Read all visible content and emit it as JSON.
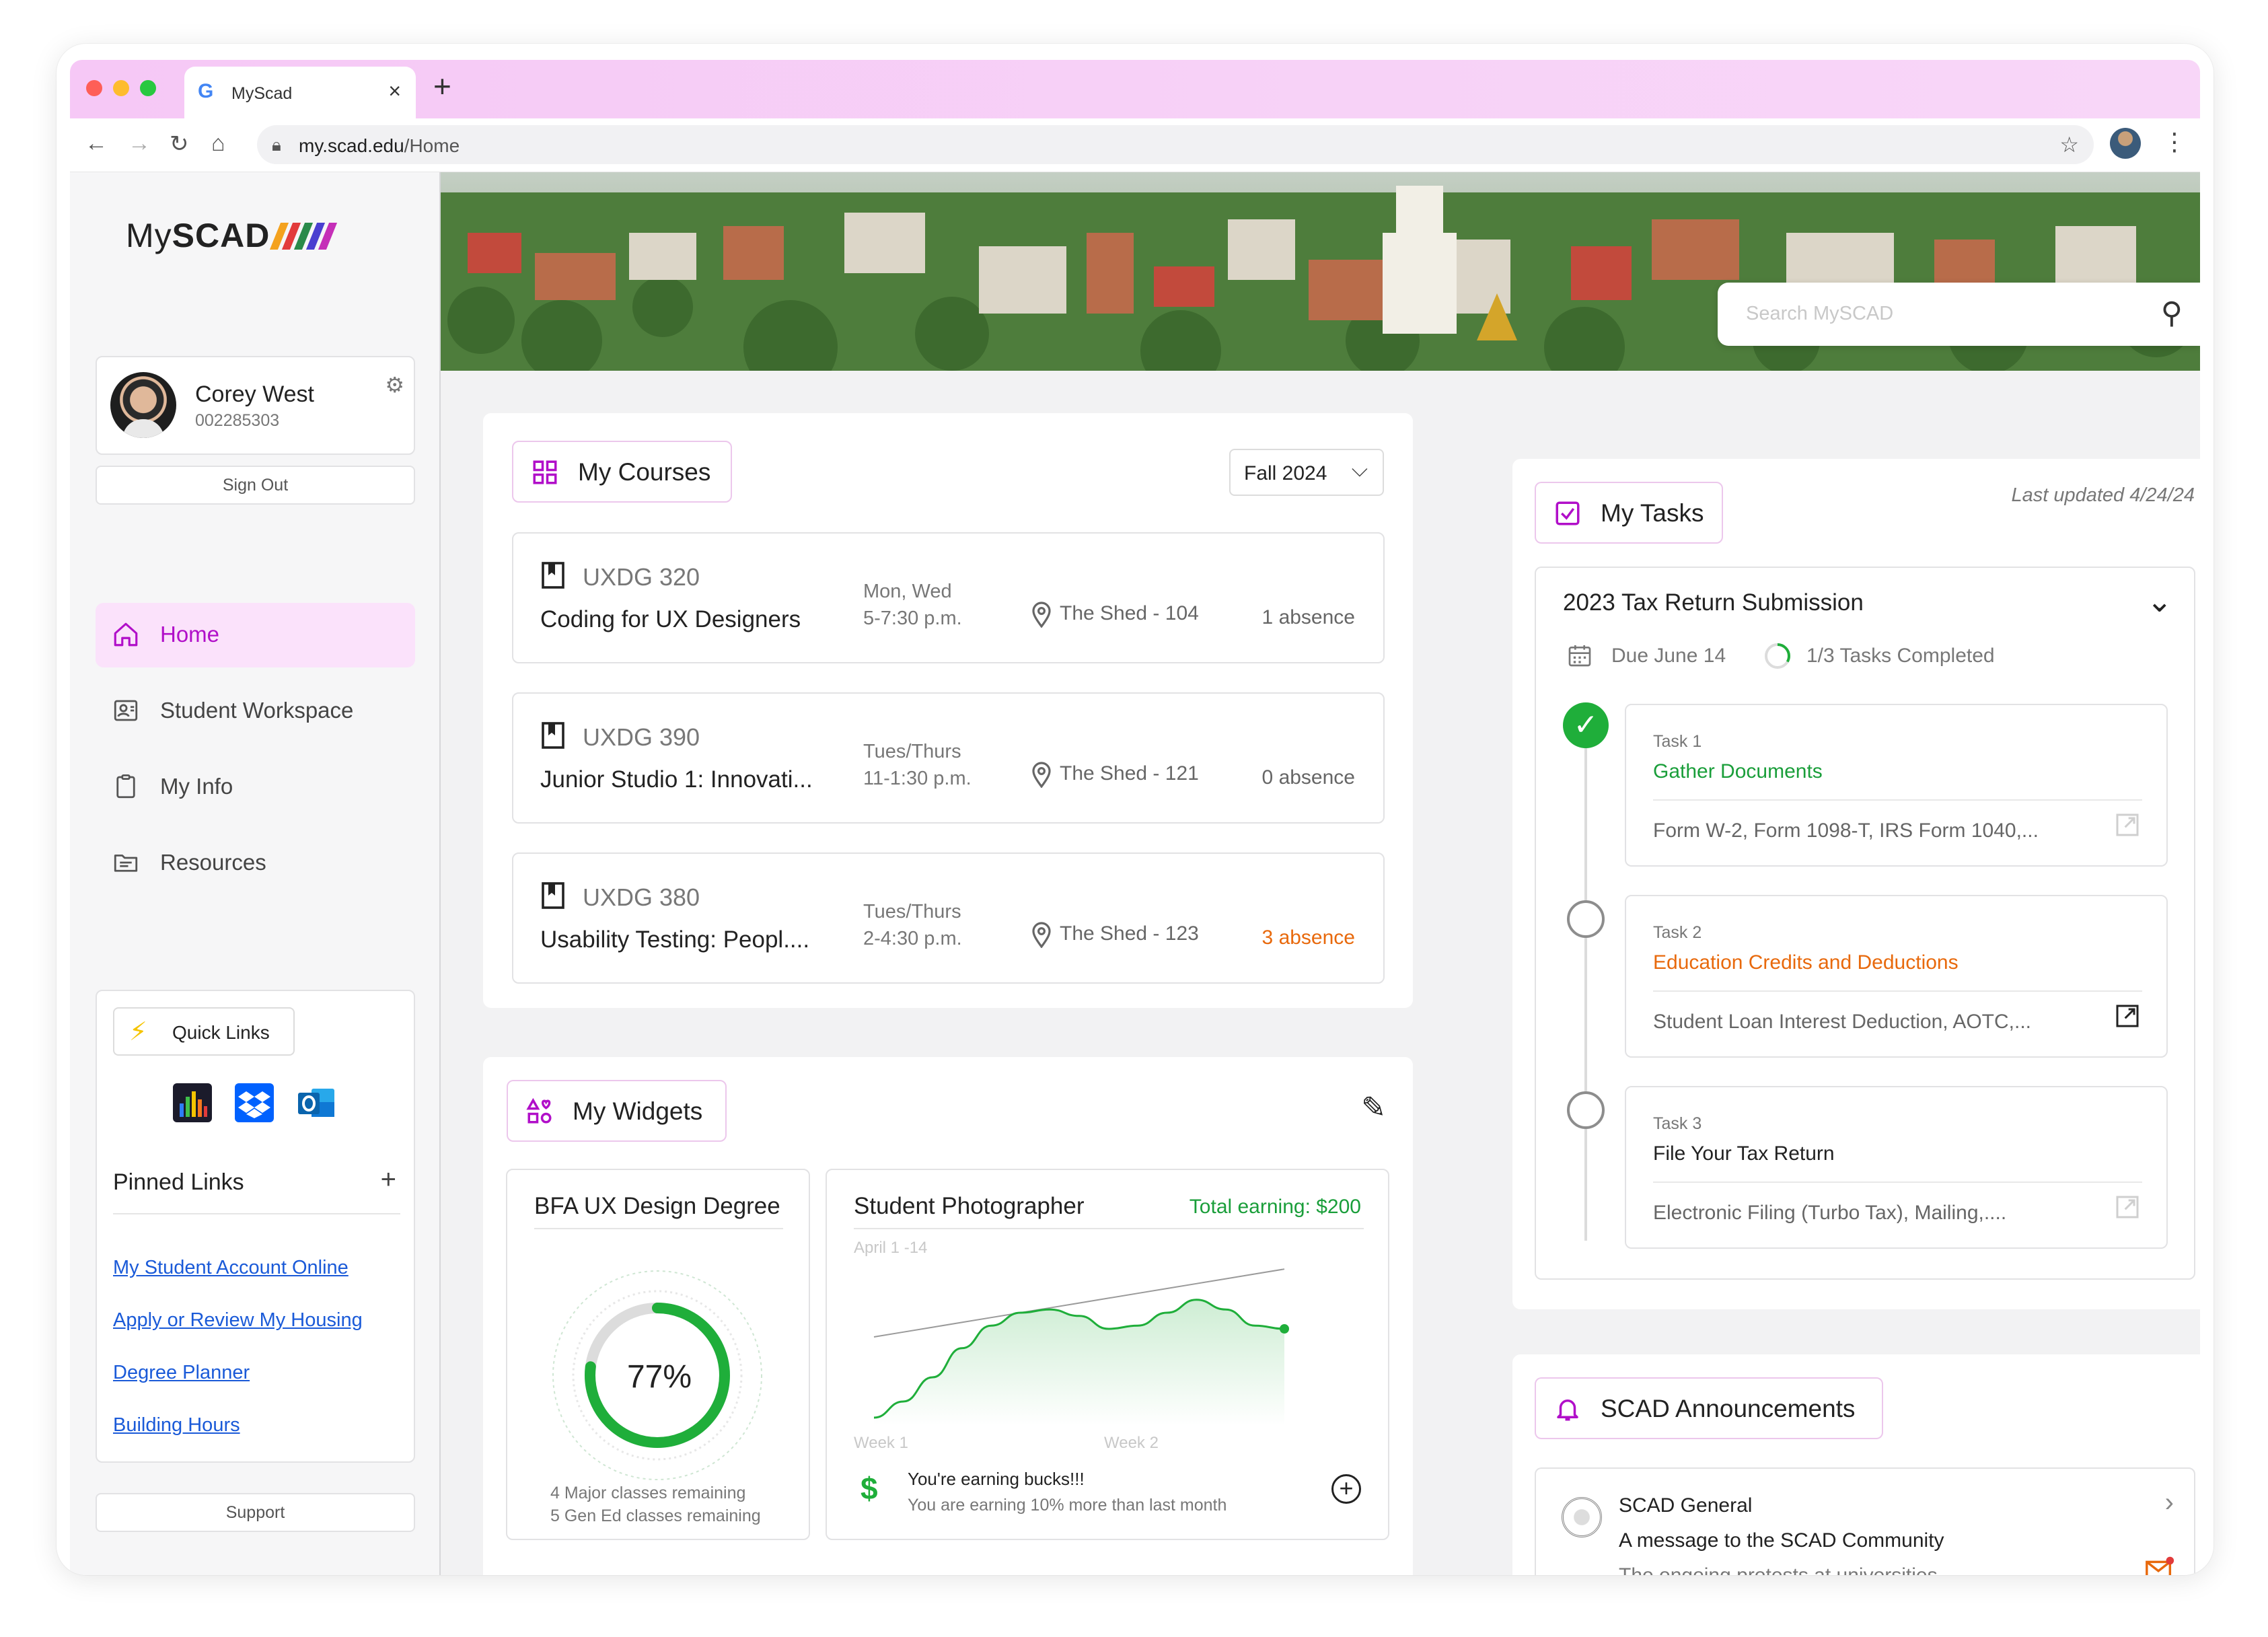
{
  "browser": {
    "tab_title": "MyScad",
    "url_host": "my.scad.edu",
    "url_path": "/Home",
    "new_tab": "+",
    "tab_close": "×"
  },
  "sidebar": {
    "logo_light": "My",
    "logo_bold": "SCAD",
    "user": {
      "name": "Corey West",
      "id": "002285303"
    },
    "sign_out": "Sign Out",
    "nav": [
      {
        "label": "Home",
        "icon": "home-icon",
        "active": true
      },
      {
        "label": "Student Workspace",
        "icon": "workspace-icon",
        "active": false
      },
      {
        "label": "My Info",
        "icon": "clipboard-icon",
        "active": false
      },
      {
        "label": "Resources",
        "icon": "folder-icon",
        "active": false
      }
    ],
    "quick_links_label": "Quick Links",
    "quick_apps": [
      "chart-app-icon",
      "dropbox-icon",
      "outlook-icon"
    ],
    "pinned_title": "Pinned Links",
    "pinned_add": "+",
    "pinned_links": [
      "My Student Account Online",
      "Apply or Review My Housing",
      "Degree Planner",
      "Building Hours"
    ],
    "support": "Support"
  },
  "hero": {
    "search_placeholder": "Search MySCAD"
  },
  "courses": {
    "title": "My Courses",
    "term": "Fall 2024",
    "items": [
      {
        "code": "UXDG 320",
        "name": "Coding for UX Designers",
        "days": "Mon, Wed",
        "time": "5-7:30 p.m.",
        "room": "The Shed - 104",
        "absence": "1 absence",
        "warn": false
      },
      {
        "code": "UXDG 390",
        "name": "Junior Studio 1: Innovati...",
        "days": "Tues/Thurs",
        "time": "11-1:30 p.m.",
        "room": "The Shed - 121",
        "absence": "0 absence",
        "warn": false
      },
      {
        "code": "UXDG 380",
        "name": "Usability Testing: Peopl....",
        "days": "Tues/Thurs",
        "time": "2-4:30 p.m.",
        "room": "The Shed - 123",
        "absence": "3 absence",
        "warn": true
      }
    ]
  },
  "widgets": {
    "title": "My Widgets",
    "degree": {
      "title": "BFA UX Design Degree",
      "percent_label": "77%",
      "percent": 0.77,
      "line1": "4 Major classes remaining",
      "line2": "5 Gen Ed classes remaining"
    },
    "photographer": {
      "title": "Student Photographer",
      "total": "Total earning: $200",
      "range": "April 1 -14",
      "week1": "Week 1",
      "week2": "Week 2",
      "earning_title": "You're earning bucks!!!",
      "earning_sub": "You are earning 10% more than last month"
    }
  },
  "chart_data": {
    "type": "area",
    "title": "",
    "xlabel": "",
    "ylabel": "",
    "x": [
      0,
      1,
      2,
      3,
      4,
      5,
      6,
      7,
      8,
      9,
      10,
      11,
      12,
      13,
      14
    ],
    "series": [
      {
        "values": [
          5,
          15,
          30,
          48,
          62,
          70,
          72,
          68,
          60,
          62,
          70,
          78,
          72,
          62,
          60
        ]
      },
      {
        "values": [
          55,
          58,
          61,
          64,
          67,
          70,
          73,
          76,
          79,
          82,
          85,
          88,
          91,
          94,
          97
        ]
      }
    ]
  },
  "tasks": {
    "title": "My Tasks",
    "updated": "Last updated 4/24/24",
    "group_title": "2023 Tax Return Submission",
    "due": "Due June 14",
    "progress": "1/3 Tasks Completed",
    "items": [
      {
        "num": "Task 1",
        "title": "Gather Documents",
        "desc": "Form W-2, Form 1098-T, IRS Form 1040,...",
        "status": "done",
        "title_color": "#1a9e3a"
      },
      {
        "num": "Task 2",
        "title": "Education Credits and Deductions",
        "desc": "Student Loan Interest Deduction, AOTC,...",
        "status": "pending",
        "title_color": "#e8690c"
      },
      {
        "num": "Task 3",
        "title": "File Your Tax Return",
        "desc": "Electronic Filing (Turbo Tax), Mailing,....",
        "status": "pending",
        "title_color": "#222222"
      }
    ]
  },
  "announcements": {
    "title": "SCAD Announcements",
    "source": "SCAD General",
    "headline": "A message to the SCAD Community",
    "preview": "The ongoing protests at universities....."
  },
  "colors": {
    "accent": "#b10fc9",
    "success": "#1a9e3a",
    "warning": "#e8690c",
    "link": "#1a5ad8"
  }
}
